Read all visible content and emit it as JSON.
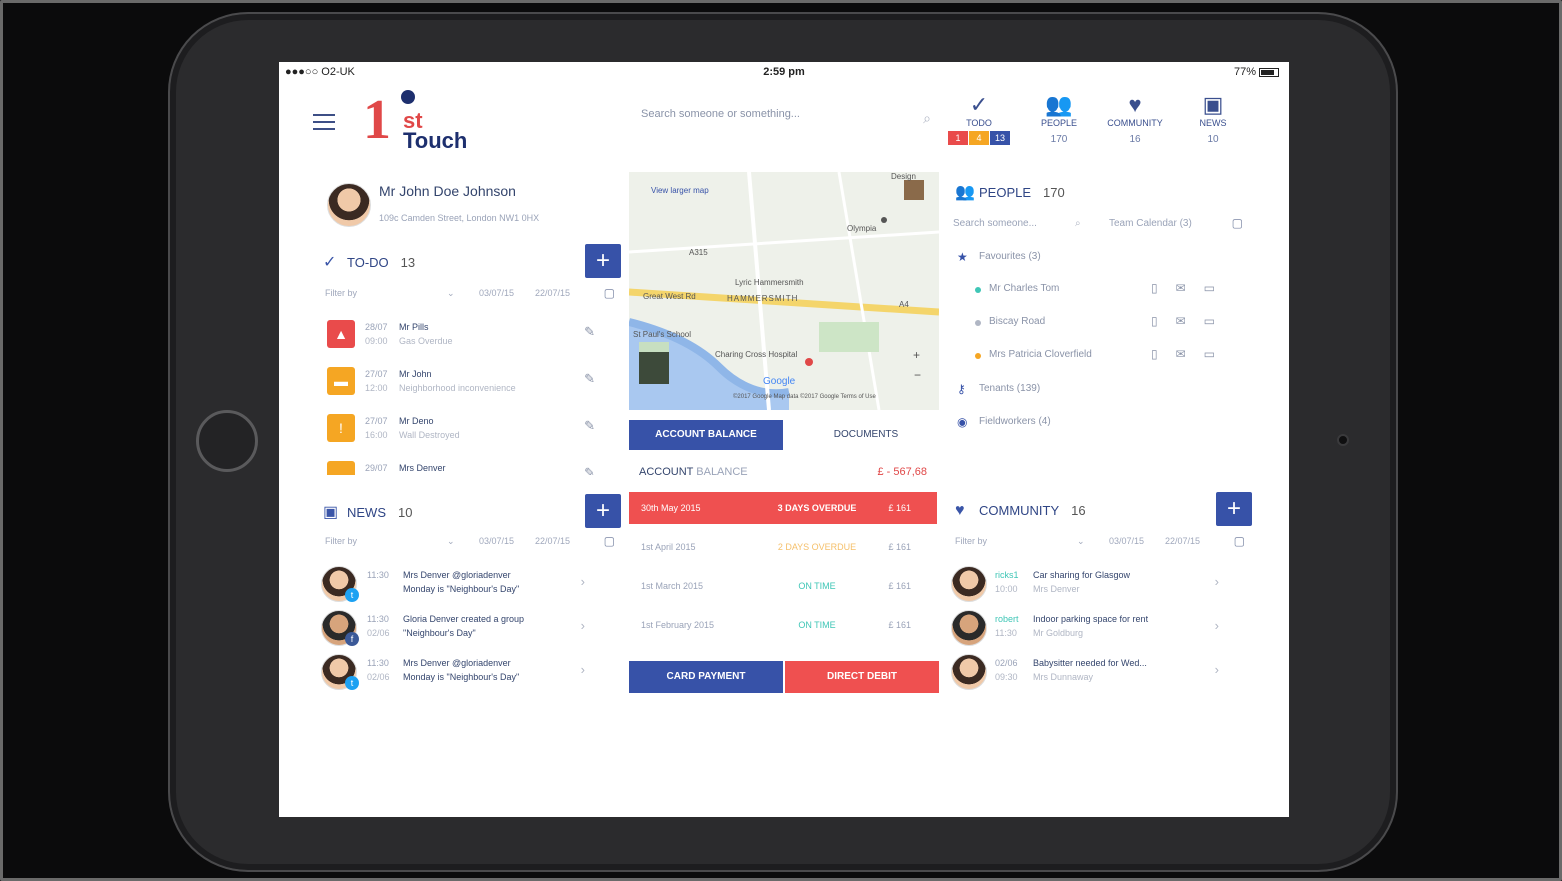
{
  "status": {
    "carrier": "●●●○○ O2-UK",
    "time": "2:59 pm",
    "battery": "77%"
  },
  "brand": {
    "one": "1",
    "st": "st",
    "touch": "Touch"
  },
  "search": {
    "placeholder": "Search someone or something..."
  },
  "topnav": [
    {
      "label": "TODO",
      "icon": "check-circle-icon",
      "badges": [
        "1",
        "4",
        "13"
      ]
    },
    {
      "label": "PEOPLE",
      "icon": "people-icon",
      "count": "170"
    },
    {
      "label": "COMMUNITY",
      "icon": "heart-icon",
      "count": "16"
    },
    {
      "label": "NEWS",
      "icon": "box-icon",
      "count": "10"
    }
  ],
  "profile": {
    "name": "Mr John Doe Johnson",
    "address": "109c Camden Street, London NW1 0HX"
  },
  "todo": {
    "title": "TO-DO",
    "count": "13",
    "filter": {
      "label": "Filter by",
      "from": "03/07/15",
      "to": "22/07/15"
    },
    "items": [
      {
        "date": "28/07",
        "time": "09:00",
        "who": "Mr Pills",
        "what": "Gas Overdue",
        "color": "#e94b4b",
        "icon": "flame-icon"
      },
      {
        "date": "27/07",
        "time": "12:00",
        "who": "Mr John",
        "what": "Neighborhood inconvenience",
        "color": "#f5a623",
        "icon": "chat-icon"
      },
      {
        "date": "27/07",
        "time": "16:00",
        "who": "Mr Deno",
        "what": "Wall Destroyed",
        "color": "#f5a623",
        "icon": "warning-icon"
      },
      {
        "date": "29/07",
        "time": "",
        "who": "Mrs Denver",
        "what": "",
        "color": "#f5a623",
        "icon": "chat-icon"
      }
    ]
  },
  "news": {
    "title": "NEWS",
    "count": "10",
    "filter": {
      "label": "Filter by",
      "from": "03/07/15",
      "to": "22/07/15"
    },
    "items": [
      {
        "time": "11:30",
        "date": "",
        "line1": "Mrs Denver @gloriadenver",
        "line2": "Monday is \"Neighbour's Day\"",
        "social": "twitter"
      },
      {
        "time": "11:30",
        "date": "02/06",
        "line1": "Gloria Denver created a group",
        "line2": "\"Neighbour's Day\"",
        "social": "facebook"
      },
      {
        "time": "11:30",
        "date": "02/06",
        "line1": "Mrs Denver @gloriadenver",
        "line2": "Monday is \"Neighbour's Day\"",
        "social": "twitter"
      }
    ]
  },
  "map": {
    "labels": [
      "View larger map",
      "Olympia",
      "Lyric Hammersmith",
      "HAMMERSMITH",
      "Great West Rd",
      "St Paul's School",
      "Charing Cross Hospital",
      "Google",
      "©2017 Google  Map data ©2017 Google  Terms of Use",
      "A315",
      "A4",
      "Design"
    ]
  },
  "tabs": {
    "active": "ACCOUNT BALANCE",
    "other": "DOCUMENTS"
  },
  "account": {
    "title_bold": "ACCOUNT",
    "title_light": "BALANCE",
    "amount": "£ - 567,68",
    "rows": [
      {
        "date": "30th May 2015",
        "status": "3 DAYS OVERDUE",
        "amount": "£ 161",
        "kind": "over"
      },
      {
        "date": "1st April 2015",
        "status": "2 DAYS OVERDUE",
        "amount": "£ 161",
        "kind": "late"
      },
      {
        "date": "1st March 2015",
        "status": "ON TIME",
        "amount": "£ 161",
        "kind": "ok"
      },
      {
        "date": "1st February 2015",
        "status": "ON TIME",
        "amount": "£ 161",
        "kind": "ok"
      }
    ],
    "card": "CARD PAYMENT",
    "debit": "DIRECT DEBIT"
  },
  "people": {
    "title": "PEOPLE",
    "count": "170",
    "search_placeholder": "Search someone...",
    "team_calendar": "Team Calendar (3)",
    "favourites": "Favourites (3)",
    "contacts": [
      {
        "name": "Mr Charles Tom",
        "dot": "#3fc6b6"
      },
      {
        "name": "Biscay Road",
        "dot": "#b0b6c4"
      },
      {
        "name": "Mrs Patricia Cloverfield",
        "dot": "#f5a623"
      }
    ],
    "tenants": "Tenants (139)",
    "fieldworkers": "Fieldworkers (4)"
  },
  "community": {
    "title": "COMMUNITY",
    "count": "16",
    "filter": {
      "label": "Filter by",
      "from": "03/07/15",
      "to": "22/07/15"
    },
    "items": [
      {
        "tag": "ricks1",
        "time": "10:00",
        "line1": "Car sharing for Glasgow",
        "line2": "Mrs Denver"
      },
      {
        "tag": "robert",
        "time": "11:30",
        "line1": "Indoor parking space for rent",
        "line2": "Mr Goldburg"
      },
      {
        "tag": "02/06",
        "time": "09:30",
        "line1": "Babysitter needed for Wed...",
        "line2": "Mrs Dunnaway"
      }
    ]
  }
}
